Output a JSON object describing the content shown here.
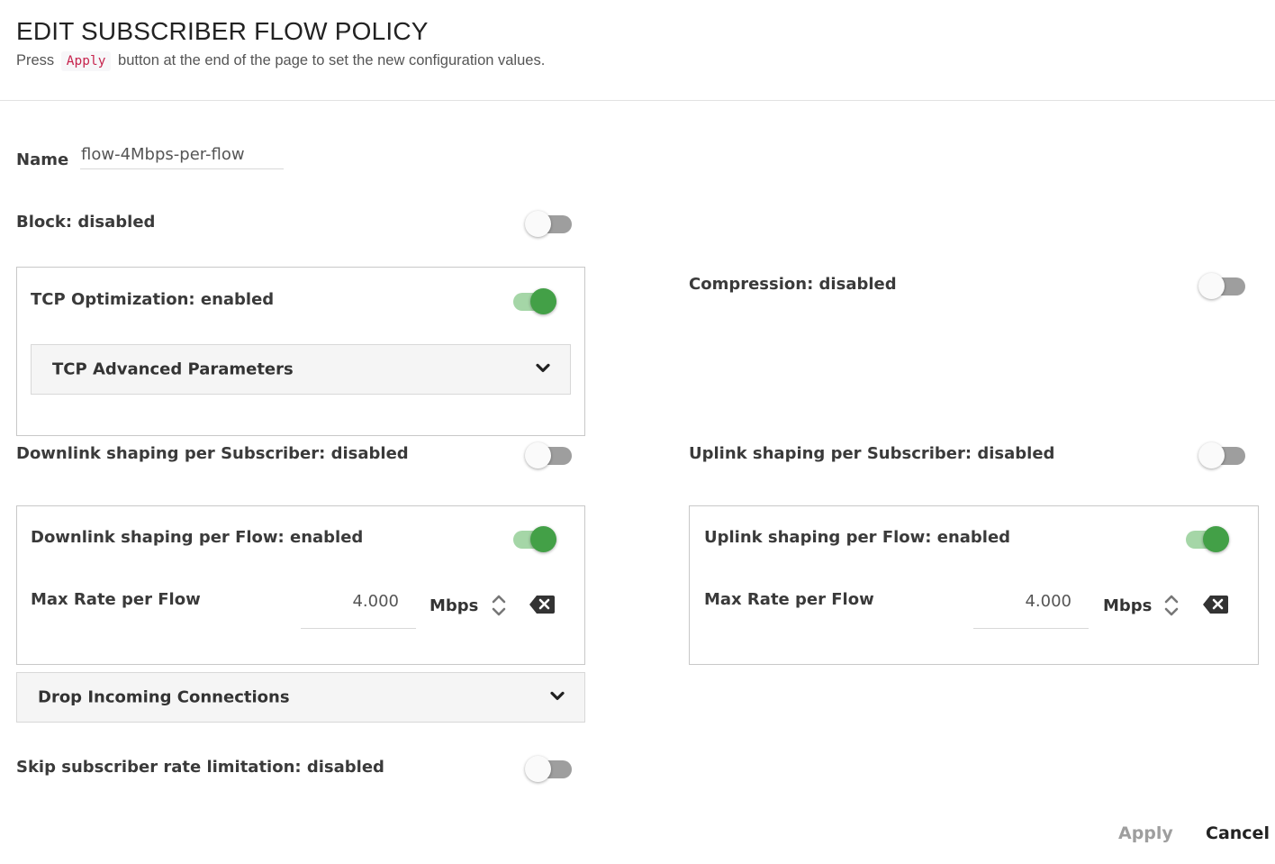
{
  "header": {
    "title": "EDIT SUBSCRIBER FLOW POLICY",
    "subtitle_pre": "Press",
    "subtitle_code": "Apply",
    "subtitle_post": "button at the end of the page to set the new configuration values."
  },
  "name": {
    "label": "Name",
    "value": "flow-4Mbps-per-flow"
  },
  "block": {
    "label": "Block: disabled",
    "enabled": false
  },
  "tcp_optimization": {
    "label": "TCP Optimization: enabled",
    "enabled": true,
    "advanced_label": "TCP Advanced Parameters"
  },
  "compression": {
    "label": "Compression: disabled",
    "enabled": false
  },
  "downlink_subscriber": {
    "label": "Downlink shaping per Subscriber: disabled",
    "enabled": false
  },
  "uplink_subscriber": {
    "label": "Uplink shaping per Subscriber: disabled",
    "enabled": false
  },
  "downlink_flow": {
    "label": "Downlink shaping per Flow: enabled",
    "enabled": true,
    "rate_label": "Max Rate per Flow",
    "rate_value": "4.000",
    "unit": "Mbps"
  },
  "uplink_flow": {
    "label": "Uplink shaping per Flow: enabled",
    "enabled": true,
    "rate_label": "Max Rate per Flow",
    "rate_value": "4.000",
    "unit": "Mbps"
  },
  "drop_incoming": {
    "label": "Drop Incoming Connections"
  },
  "skip_rate_limit": {
    "label": "Skip subscriber rate limitation: disabled",
    "enabled": false
  },
  "actions": {
    "apply_label": "Apply",
    "cancel_label": "Cancel"
  },
  "colors": {
    "toggle_on_knob": "#43a047",
    "toggle_on_track": "#a5d6a7",
    "toggle_off_track": "#9e9e9e",
    "code_text": "#c7254e",
    "apply_disabled": "#9e9e9e",
    "cancel": "#222222"
  },
  "icons": {
    "accordion": "chevron-down-icon",
    "stepper": "up-down-chevron-icon",
    "clear": "backspace-x-icon"
  }
}
